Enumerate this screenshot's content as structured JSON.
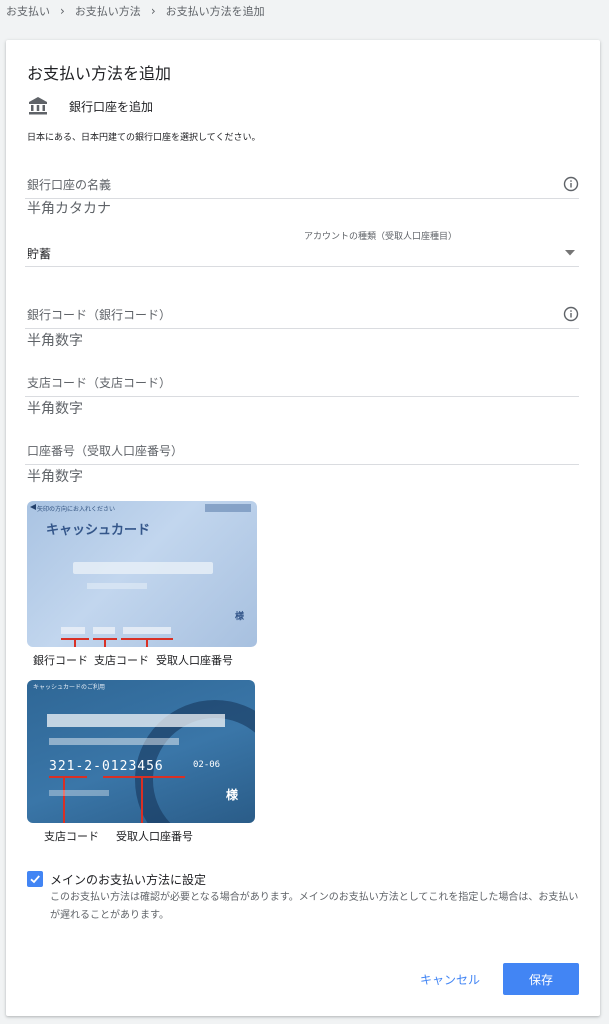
{
  "breadcrumb": [
    "お支払い",
    "お支払い方法",
    "お支払い方法を追加"
  ],
  "page_title": "お支払い方法を追加",
  "method": {
    "icon": "bank-icon",
    "label": "銀行口座を追加"
  },
  "instruction": "日本にある、日本円建ての銀行口座を選択してください。",
  "fields": {
    "account_name": {
      "label": "銀行口座の名義",
      "placeholder": "半角カタカナ",
      "icon": "info-icon"
    },
    "account_type": {
      "label": "アカウントの種類（受取人口座種目）",
      "value": "貯蓄",
      "icon": "dropdown-arrow-icon"
    },
    "bank_code": {
      "label": "銀行コード（銀行コード）",
      "placeholder": "半角数字",
      "icon": "info-icon"
    },
    "branch_code": {
      "label": "支店コード（支店コード）",
      "placeholder": "半角数字"
    },
    "account_number": {
      "label": "口座番号（受取人口座番号）",
      "placeholder": "半角数字"
    }
  },
  "card_example_1": {
    "header": "矢印の方向にお入れください",
    "title": "キャッシュカード",
    "sama": "様",
    "captions": {
      "bank_code": "銀行コード",
      "branch_code": "支店コード",
      "account_number": "受取人口座番号"
    }
  },
  "card_example_2": {
    "header": "キャッシュカードのご利用",
    "number": "321-2-0123456",
    "expiry": "02-06",
    "sama": "様",
    "captions": {
      "branch_code": "支店コード",
      "account_number": "受取人口座番号"
    }
  },
  "default_option": {
    "checked": true,
    "label": "メインのお支払い方法に設定",
    "description": "このお支払い方法は確認が必要となる場合があります。メインのお支払い方法としてこれを指定した場合は、お支払いが遅れることがあります。"
  },
  "actions": {
    "cancel": "キャンセル",
    "save": "保存"
  },
  "colors": {
    "accent": "#4285f4",
    "text": "#202124",
    "secondary": "#5f6368",
    "divider": "#dadce0",
    "marker": "#d93025"
  }
}
